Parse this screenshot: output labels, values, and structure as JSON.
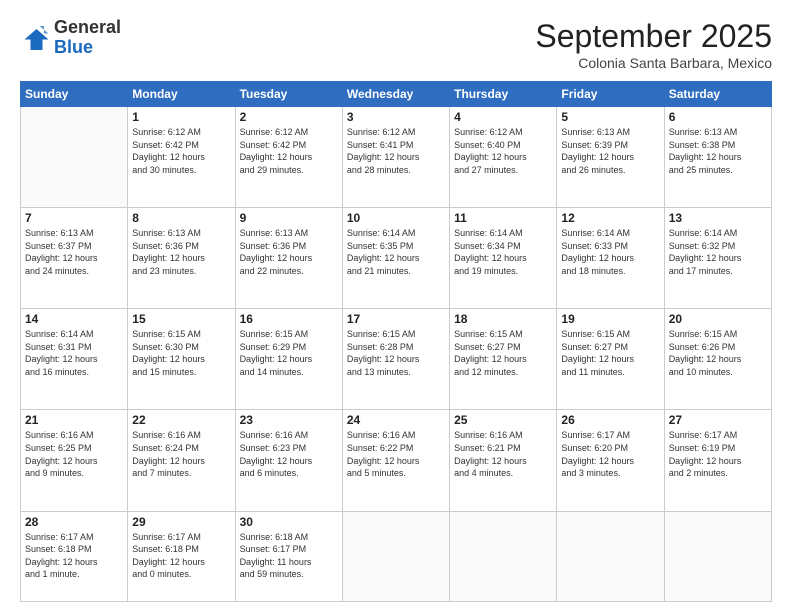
{
  "header": {
    "logo_general": "General",
    "logo_blue": "Blue",
    "month_title": "September 2025",
    "subtitle": "Colonia Santa Barbara, Mexico"
  },
  "weekdays": [
    "Sunday",
    "Monday",
    "Tuesday",
    "Wednesday",
    "Thursday",
    "Friday",
    "Saturday"
  ],
  "weeks": [
    [
      {
        "day": "",
        "info": ""
      },
      {
        "day": "1",
        "info": "Sunrise: 6:12 AM\nSunset: 6:42 PM\nDaylight: 12 hours\nand 30 minutes."
      },
      {
        "day": "2",
        "info": "Sunrise: 6:12 AM\nSunset: 6:42 PM\nDaylight: 12 hours\nand 29 minutes."
      },
      {
        "day": "3",
        "info": "Sunrise: 6:12 AM\nSunset: 6:41 PM\nDaylight: 12 hours\nand 28 minutes."
      },
      {
        "day": "4",
        "info": "Sunrise: 6:12 AM\nSunset: 6:40 PM\nDaylight: 12 hours\nand 27 minutes."
      },
      {
        "day": "5",
        "info": "Sunrise: 6:13 AM\nSunset: 6:39 PM\nDaylight: 12 hours\nand 26 minutes."
      },
      {
        "day": "6",
        "info": "Sunrise: 6:13 AM\nSunset: 6:38 PM\nDaylight: 12 hours\nand 25 minutes."
      }
    ],
    [
      {
        "day": "7",
        "info": "Sunrise: 6:13 AM\nSunset: 6:37 PM\nDaylight: 12 hours\nand 24 minutes."
      },
      {
        "day": "8",
        "info": "Sunrise: 6:13 AM\nSunset: 6:36 PM\nDaylight: 12 hours\nand 23 minutes."
      },
      {
        "day": "9",
        "info": "Sunrise: 6:13 AM\nSunset: 6:36 PM\nDaylight: 12 hours\nand 22 minutes."
      },
      {
        "day": "10",
        "info": "Sunrise: 6:14 AM\nSunset: 6:35 PM\nDaylight: 12 hours\nand 21 minutes."
      },
      {
        "day": "11",
        "info": "Sunrise: 6:14 AM\nSunset: 6:34 PM\nDaylight: 12 hours\nand 19 minutes."
      },
      {
        "day": "12",
        "info": "Sunrise: 6:14 AM\nSunset: 6:33 PM\nDaylight: 12 hours\nand 18 minutes."
      },
      {
        "day": "13",
        "info": "Sunrise: 6:14 AM\nSunset: 6:32 PM\nDaylight: 12 hours\nand 17 minutes."
      }
    ],
    [
      {
        "day": "14",
        "info": "Sunrise: 6:14 AM\nSunset: 6:31 PM\nDaylight: 12 hours\nand 16 minutes."
      },
      {
        "day": "15",
        "info": "Sunrise: 6:15 AM\nSunset: 6:30 PM\nDaylight: 12 hours\nand 15 minutes."
      },
      {
        "day": "16",
        "info": "Sunrise: 6:15 AM\nSunset: 6:29 PM\nDaylight: 12 hours\nand 14 minutes."
      },
      {
        "day": "17",
        "info": "Sunrise: 6:15 AM\nSunset: 6:28 PM\nDaylight: 12 hours\nand 13 minutes."
      },
      {
        "day": "18",
        "info": "Sunrise: 6:15 AM\nSunset: 6:27 PM\nDaylight: 12 hours\nand 12 minutes."
      },
      {
        "day": "19",
        "info": "Sunrise: 6:15 AM\nSunset: 6:27 PM\nDaylight: 12 hours\nand 11 minutes."
      },
      {
        "day": "20",
        "info": "Sunrise: 6:15 AM\nSunset: 6:26 PM\nDaylight: 12 hours\nand 10 minutes."
      }
    ],
    [
      {
        "day": "21",
        "info": "Sunrise: 6:16 AM\nSunset: 6:25 PM\nDaylight: 12 hours\nand 9 minutes."
      },
      {
        "day": "22",
        "info": "Sunrise: 6:16 AM\nSunset: 6:24 PM\nDaylight: 12 hours\nand 7 minutes."
      },
      {
        "day": "23",
        "info": "Sunrise: 6:16 AM\nSunset: 6:23 PM\nDaylight: 12 hours\nand 6 minutes."
      },
      {
        "day": "24",
        "info": "Sunrise: 6:16 AM\nSunset: 6:22 PM\nDaylight: 12 hours\nand 5 minutes."
      },
      {
        "day": "25",
        "info": "Sunrise: 6:16 AM\nSunset: 6:21 PM\nDaylight: 12 hours\nand 4 minutes."
      },
      {
        "day": "26",
        "info": "Sunrise: 6:17 AM\nSunset: 6:20 PM\nDaylight: 12 hours\nand 3 minutes."
      },
      {
        "day": "27",
        "info": "Sunrise: 6:17 AM\nSunset: 6:19 PM\nDaylight: 12 hours\nand 2 minutes."
      }
    ],
    [
      {
        "day": "28",
        "info": "Sunrise: 6:17 AM\nSunset: 6:18 PM\nDaylight: 12 hours\nand 1 minute."
      },
      {
        "day": "29",
        "info": "Sunrise: 6:17 AM\nSunset: 6:18 PM\nDaylight: 12 hours\nand 0 minutes."
      },
      {
        "day": "30",
        "info": "Sunrise: 6:18 AM\nSunset: 6:17 PM\nDaylight: 11 hours\nand 59 minutes."
      },
      {
        "day": "",
        "info": ""
      },
      {
        "day": "",
        "info": ""
      },
      {
        "day": "",
        "info": ""
      },
      {
        "day": "",
        "info": ""
      }
    ]
  ]
}
